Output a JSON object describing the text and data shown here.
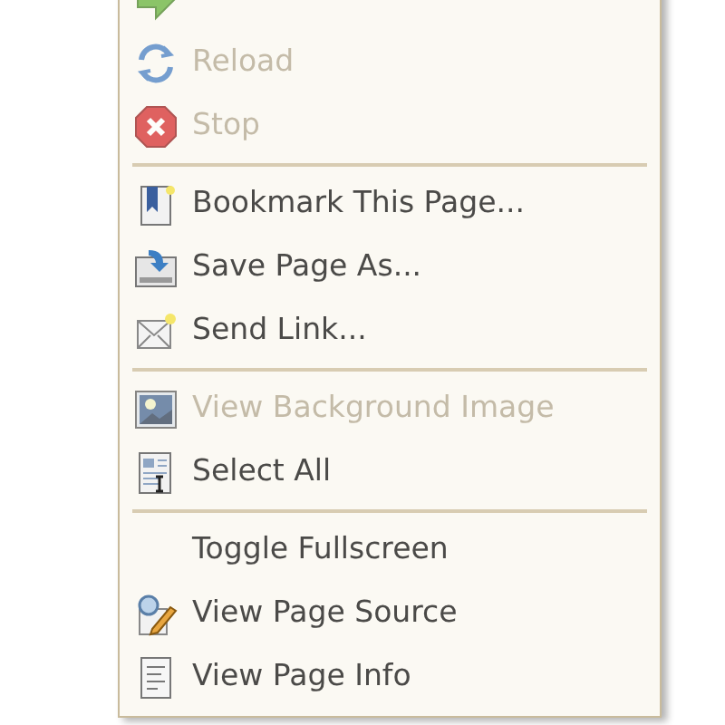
{
  "menu": {
    "items": [
      {
        "kind": "item",
        "disabled": true
      },
      {
        "kind": "item",
        "label": "Reload",
        "disabled": true
      },
      {
        "kind": "item",
        "label": "Stop",
        "disabled": true
      },
      {
        "kind": "separator"
      },
      {
        "kind": "item",
        "label": "Bookmark This Page...",
        "disabled": false
      },
      {
        "kind": "item",
        "label": "Save Page As...",
        "disabled": false
      },
      {
        "kind": "item",
        "label": "Send Link...",
        "disabled": false
      },
      {
        "kind": "separator"
      },
      {
        "kind": "item",
        "label": "View Background Image",
        "disabled": true
      },
      {
        "kind": "item",
        "label": "Select All",
        "disabled": false
      },
      {
        "kind": "separator"
      },
      {
        "kind": "item",
        "label": "Toggle Fullscreen",
        "disabled": false
      },
      {
        "kind": "item",
        "label": "View Page Source",
        "disabled": false
      },
      {
        "kind": "item",
        "label": "View Page Info",
        "disabled": false
      }
    ]
  }
}
